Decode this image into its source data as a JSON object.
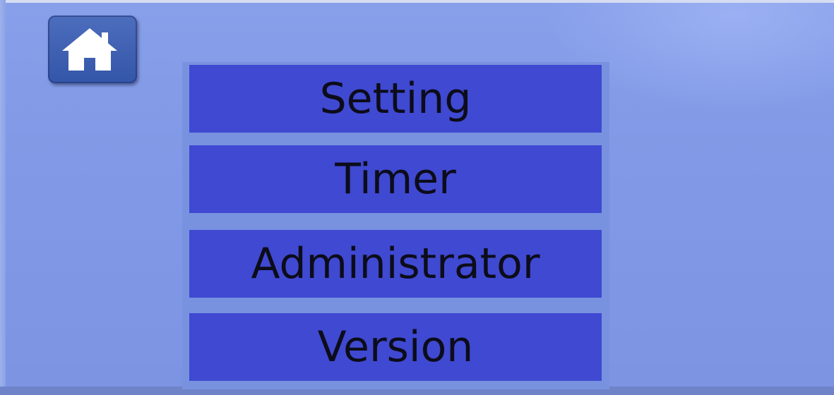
{
  "home": {
    "icon": "home-icon",
    "color": "#3f5fb3"
  },
  "menu": {
    "items": [
      {
        "label": "Setting"
      },
      {
        "label": "Timer"
      },
      {
        "label": "Administrator"
      },
      {
        "label": "Version"
      }
    ],
    "item_color": "#3f49d1",
    "text_color": "#0c0c1a",
    "background_color": "#7e97e6"
  }
}
